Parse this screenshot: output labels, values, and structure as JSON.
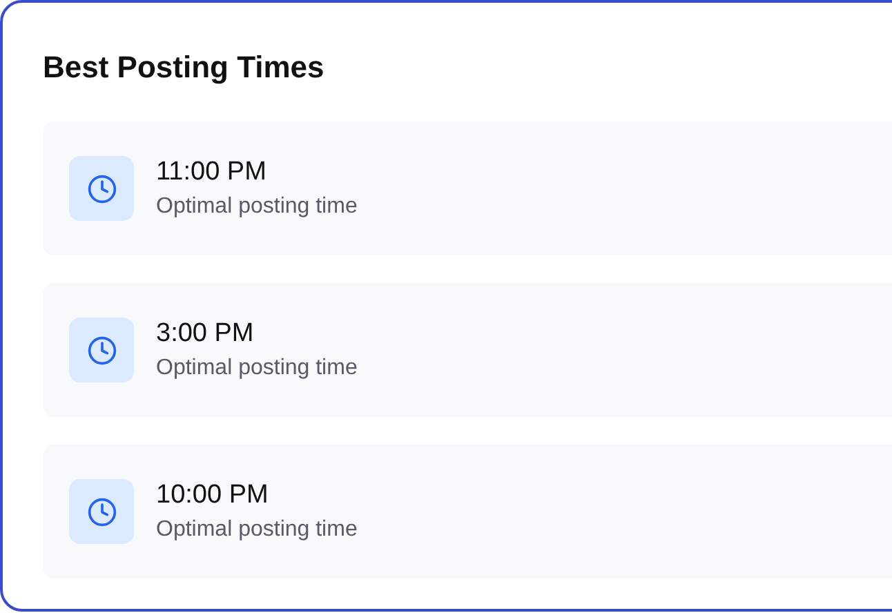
{
  "card": {
    "title": "Best Posting Times"
  },
  "times": [
    {
      "time": "11:00 PM",
      "description": "Optimal posting time"
    },
    {
      "time": "3:00 PM",
      "description": "Optimal posting time"
    },
    {
      "time": "10:00 PM",
      "description": "Optimal posting time"
    }
  ]
}
